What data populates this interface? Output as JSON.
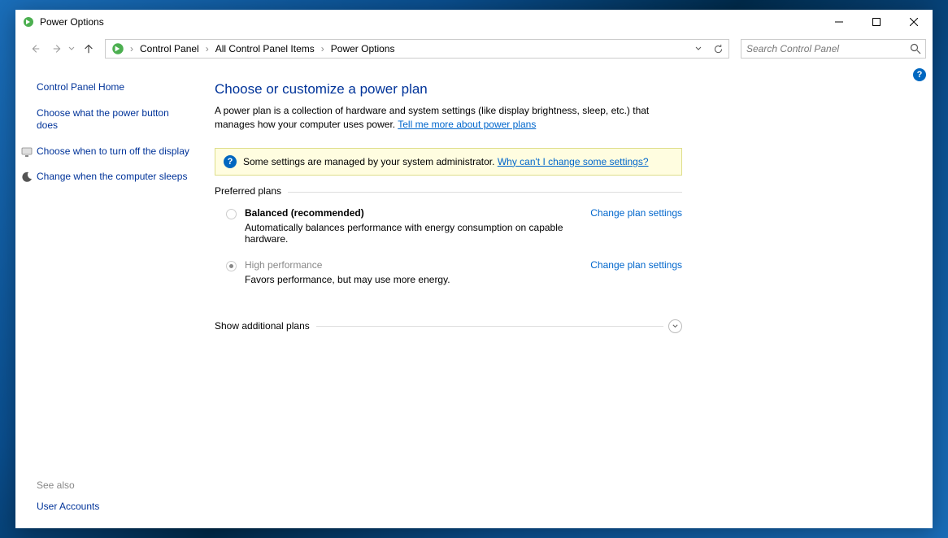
{
  "window": {
    "title": "Power Options"
  },
  "breadcrumbs": {
    "items": [
      "Control Panel",
      "All Control Panel Items",
      "Power Options"
    ]
  },
  "search": {
    "placeholder": "Search Control Panel"
  },
  "sidebar": {
    "home_label": "Control Panel Home",
    "links": [
      {
        "label": "Choose what the power button does",
        "icon": null
      },
      {
        "label": "Choose when to turn off the display",
        "icon": "monitor"
      },
      {
        "label": "Change when the computer sleeps",
        "icon": "moon"
      }
    ],
    "see_also_label": "See also",
    "see_also_items": [
      "User Accounts"
    ]
  },
  "main": {
    "title": "Choose or customize a power plan",
    "description_pre": "A power plan is a collection of hardware and system settings (like display brightness, sleep, etc.) that manages how your computer uses power. ",
    "description_link": "Tell me more about power plans",
    "warning_text": "Some settings are managed by your system administrator. ",
    "warning_link": "Why can't I change some settings?",
    "preferred_label": "Preferred plans",
    "plans": [
      {
        "name": "Balanced (recommended)",
        "desc": "Automatically balances performance with energy consumption on capable hardware.",
        "checked": false,
        "disabled": true,
        "bold": true,
        "change_label": "Change plan settings"
      },
      {
        "name": "High performance",
        "desc": "Favors performance, but may use more energy.",
        "checked": true,
        "disabled": true,
        "bold": false,
        "change_label": "Change plan settings"
      }
    ],
    "additional_label": "Show additional plans"
  }
}
